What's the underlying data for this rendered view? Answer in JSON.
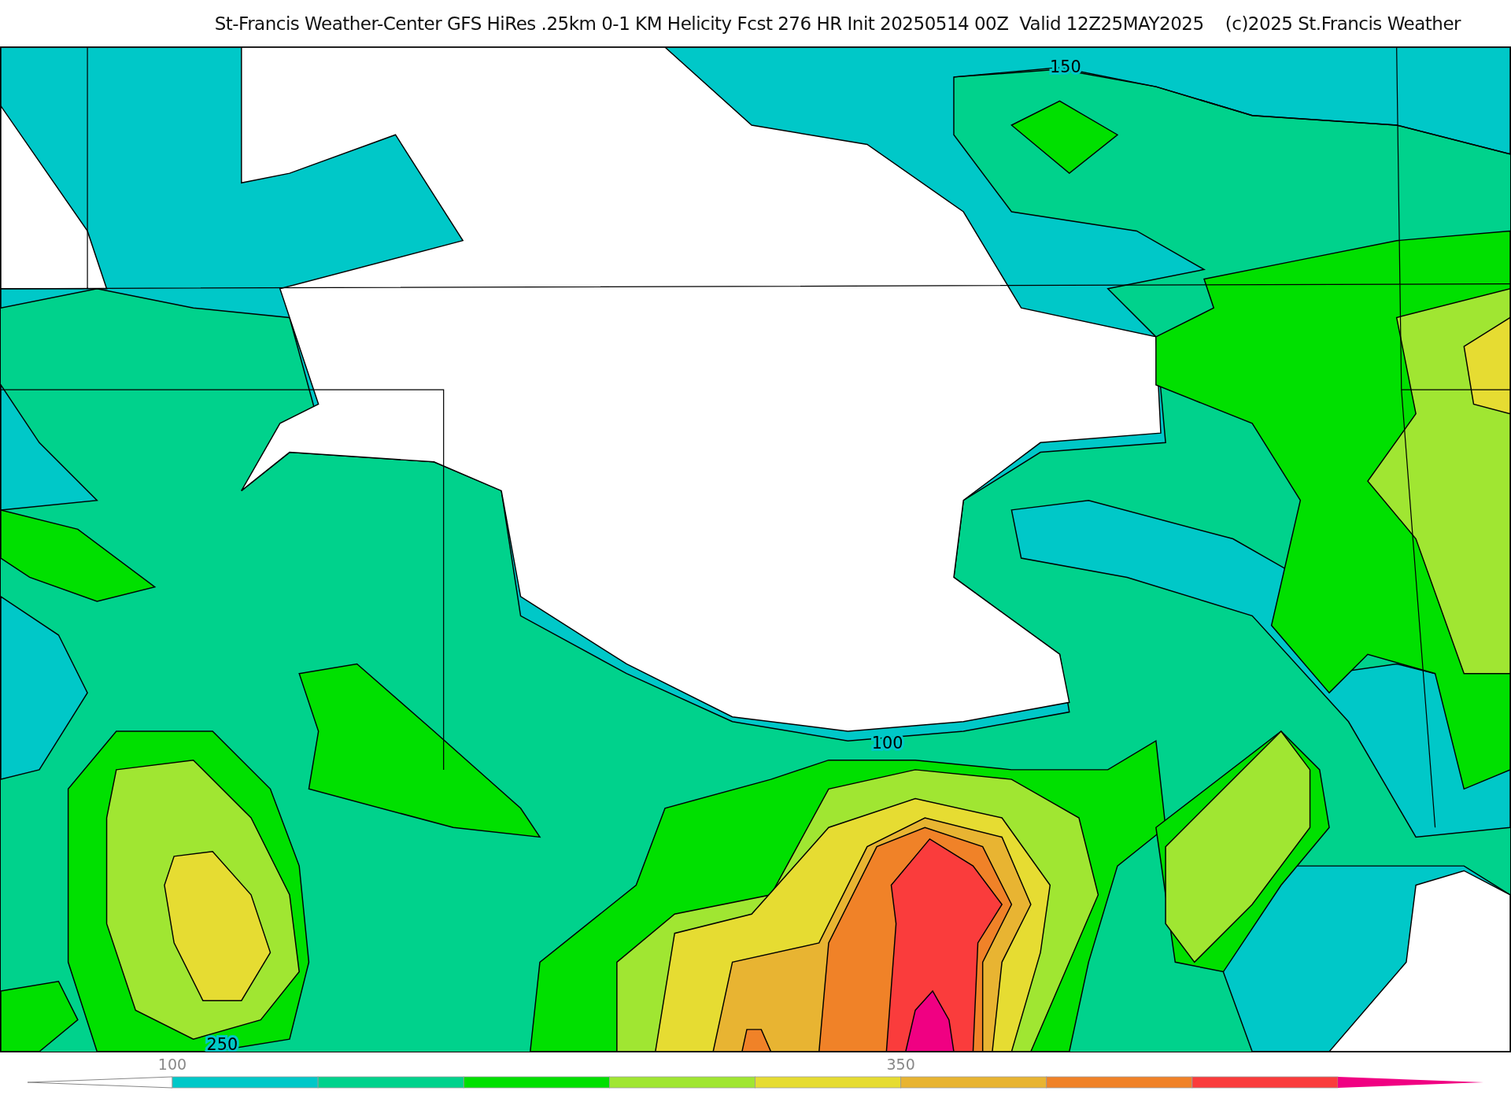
{
  "title": "St-Francis Weather-Center GFS HiRes .25km 0-1 KM Helicity Fcst 276 HR Init 20250514 00Z  Valid 12Z25MAY2025    (c)2025 St.Francis Weather",
  "map": {
    "contour_labels": [
      "150",
      "100",
      "250"
    ]
  },
  "colorbar": {
    "tick_labels": [
      "100",
      "350"
    ],
    "segments": [
      {
        "color": "#00c8c8"
      },
      {
        "color": "#00d28c"
      },
      {
        "color": "#00e000"
      },
      {
        "color": "#a0e632"
      },
      {
        "color": "#e6dc32"
      },
      {
        "color": "#e8b432"
      },
      {
        "color": "#f08228"
      },
      {
        "color": "#fa3c3c"
      }
    ],
    "low_end": {
      "color": "#ffffff"
    },
    "high_end": {
      "color": "#f00082"
    }
  }
}
